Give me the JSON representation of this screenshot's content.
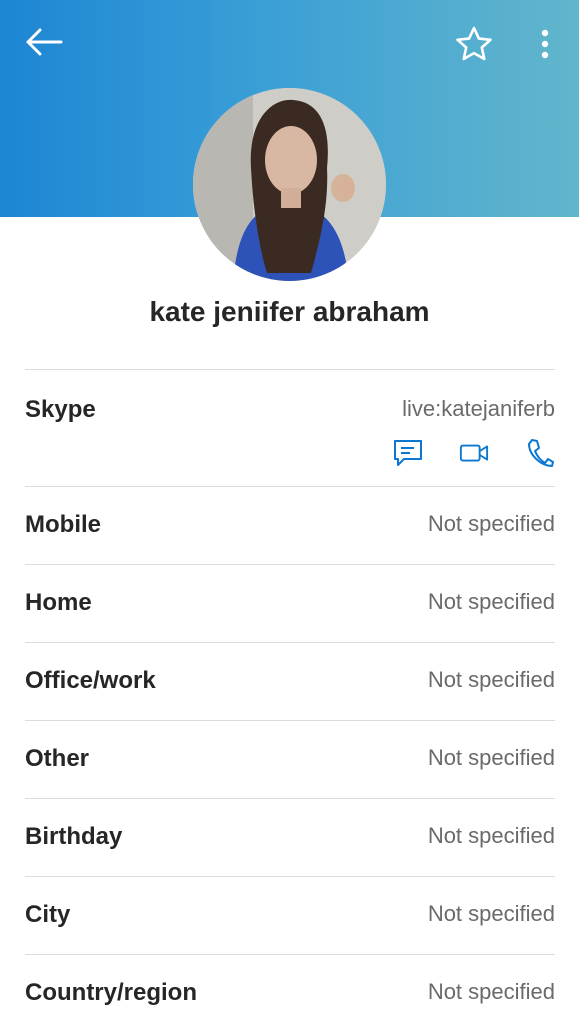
{
  "header": {
    "back_icon": "arrow-left-icon",
    "favorite_icon": "star-outline-icon",
    "more_icon": "more-vertical-icon",
    "gradient_colors": [
      "#1d86d4",
      "#62b6cc"
    ]
  },
  "profile": {
    "name": "kate jeniifer abraham"
  },
  "skype": {
    "label": "Skype",
    "value": "live:katejaniferb",
    "actions": [
      "chat-icon",
      "video-call-icon",
      "phone-icon"
    ],
    "accent_color": "#0a78d2"
  },
  "details": [
    {
      "label": "Mobile",
      "value": "Not specified"
    },
    {
      "label": "Home",
      "value": "Not specified"
    },
    {
      "label": "Office/work",
      "value": "Not specified"
    },
    {
      "label": "Other",
      "value": "Not specified"
    },
    {
      "label": "Birthday",
      "value": "Not specified"
    },
    {
      "label": "City",
      "value": "Not specified"
    },
    {
      "label": "Country/region",
      "value": "Not specified"
    }
  ]
}
